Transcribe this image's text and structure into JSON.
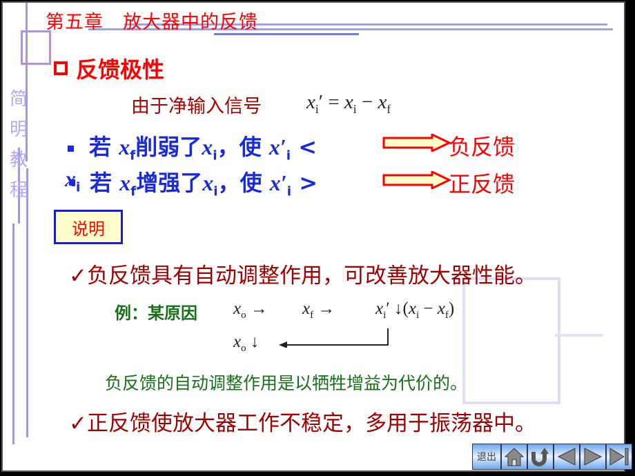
{
  "header": {
    "chapter_title": "第五章　放大器中的反馈",
    "side_watermark": [
      "简",
      "明",
      "教",
      "程"
    ]
  },
  "section": {
    "icon": "hollow-square-bullet-icon",
    "title": "反馈极性"
  },
  "net_input": {
    "label": "由于净输入信号",
    "equation": "x′i = xi − xf"
  },
  "polarity_rules": [
    {
      "bullet_icon": "square-bullet-icon",
      "pre": "若",
      "var1": "x",
      "sub1": "f",
      "verb": "削弱了",
      "var2": "x",
      "sub2": "i",
      "mid": "，使",
      "var3": "x′",
      "sub3": "i",
      "comp": "<",
      "tail_var": "x",
      "tail_sub": "i",
      "arrow_icon": "right-block-arrow-icon",
      "result": "负反馈"
    },
    {
      "bullet_icon": "square-bullet-icon",
      "pre": "若",
      "var1": "x",
      "sub1": "f",
      "verb": "增强了",
      "var2": "x",
      "sub2": "i",
      "mid": "，使",
      "var3": "x′",
      "sub3": "i",
      "comp": ">",
      "arrow_icon": "right-block-arrow-icon",
      "result": "正反馈"
    }
  ],
  "note": {
    "label": "说明"
  },
  "points": [
    {
      "check_icon": "checkmark-icon",
      "text": "负反馈具有自动调整作用，可改善放大器性能。"
    },
    {
      "check_icon": "checkmark-icon",
      "text": "正反馈使放大器工作不稳定，多用于振荡器中。"
    }
  ],
  "example": {
    "label": "例：某原因",
    "chain": [
      "xo →",
      "xf →",
      "x′i ↓ (xi − xf)"
    ],
    "result": "xo ↓",
    "conclusion": "负反馈的自动调整作用是以牺牲增益为代价的。"
  },
  "navigation": {
    "exit_label": "退出",
    "buttons": [
      "home",
      "return",
      "previous",
      "next",
      "last"
    ]
  },
  "colors": {
    "title_red": "#ff0000",
    "dark_red": "#9e0000",
    "blue": "#1a2ad4",
    "green": "#187018",
    "note_bg": "#ffffcc"
  }
}
